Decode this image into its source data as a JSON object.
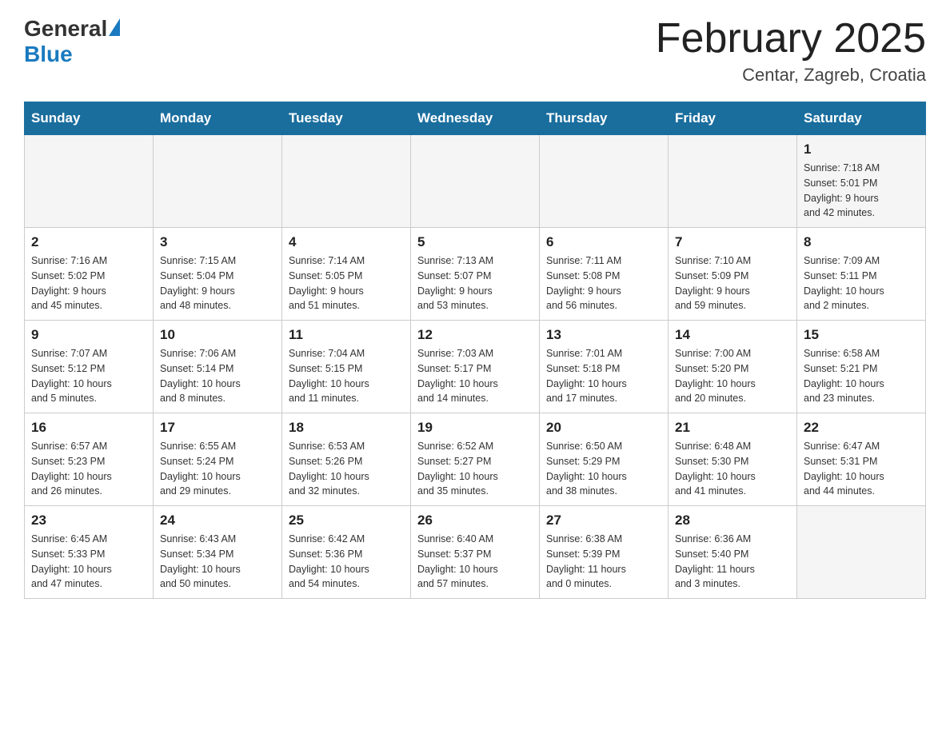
{
  "header": {
    "logo_general": "General",
    "logo_blue": "Blue",
    "month_title": "February 2025",
    "location": "Centar, Zagreb, Croatia"
  },
  "days_of_week": [
    "Sunday",
    "Monday",
    "Tuesday",
    "Wednesday",
    "Thursday",
    "Friday",
    "Saturday"
  ],
  "weeks": [
    [
      {
        "day": "",
        "info": ""
      },
      {
        "day": "",
        "info": ""
      },
      {
        "day": "",
        "info": ""
      },
      {
        "day": "",
        "info": ""
      },
      {
        "day": "",
        "info": ""
      },
      {
        "day": "",
        "info": ""
      },
      {
        "day": "1",
        "info": "Sunrise: 7:18 AM\nSunset: 5:01 PM\nDaylight: 9 hours\nand 42 minutes."
      }
    ],
    [
      {
        "day": "2",
        "info": "Sunrise: 7:16 AM\nSunset: 5:02 PM\nDaylight: 9 hours\nand 45 minutes."
      },
      {
        "day": "3",
        "info": "Sunrise: 7:15 AM\nSunset: 5:04 PM\nDaylight: 9 hours\nand 48 minutes."
      },
      {
        "day": "4",
        "info": "Sunrise: 7:14 AM\nSunset: 5:05 PM\nDaylight: 9 hours\nand 51 minutes."
      },
      {
        "day": "5",
        "info": "Sunrise: 7:13 AM\nSunset: 5:07 PM\nDaylight: 9 hours\nand 53 minutes."
      },
      {
        "day": "6",
        "info": "Sunrise: 7:11 AM\nSunset: 5:08 PM\nDaylight: 9 hours\nand 56 minutes."
      },
      {
        "day": "7",
        "info": "Sunrise: 7:10 AM\nSunset: 5:09 PM\nDaylight: 9 hours\nand 59 minutes."
      },
      {
        "day": "8",
        "info": "Sunrise: 7:09 AM\nSunset: 5:11 PM\nDaylight: 10 hours\nand 2 minutes."
      }
    ],
    [
      {
        "day": "9",
        "info": "Sunrise: 7:07 AM\nSunset: 5:12 PM\nDaylight: 10 hours\nand 5 minutes."
      },
      {
        "day": "10",
        "info": "Sunrise: 7:06 AM\nSunset: 5:14 PM\nDaylight: 10 hours\nand 8 minutes."
      },
      {
        "day": "11",
        "info": "Sunrise: 7:04 AM\nSunset: 5:15 PM\nDaylight: 10 hours\nand 11 minutes."
      },
      {
        "day": "12",
        "info": "Sunrise: 7:03 AM\nSunset: 5:17 PM\nDaylight: 10 hours\nand 14 minutes."
      },
      {
        "day": "13",
        "info": "Sunrise: 7:01 AM\nSunset: 5:18 PM\nDaylight: 10 hours\nand 17 minutes."
      },
      {
        "day": "14",
        "info": "Sunrise: 7:00 AM\nSunset: 5:20 PM\nDaylight: 10 hours\nand 20 minutes."
      },
      {
        "day": "15",
        "info": "Sunrise: 6:58 AM\nSunset: 5:21 PM\nDaylight: 10 hours\nand 23 minutes."
      }
    ],
    [
      {
        "day": "16",
        "info": "Sunrise: 6:57 AM\nSunset: 5:23 PM\nDaylight: 10 hours\nand 26 minutes."
      },
      {
        "day": "17",
        "info": "Sunrise: 6:55 AM\nSunset: 5:24 PM\nDaylight: 10 hours\nand 29 minutes."
      },
      {
        "day": "18",
        "info": "Sunrise: 6:53 AM\nSunset: 5:26 PM\nDaylight: 10 hours\nand 32 minutes."
      },
      {
        "day": "19",
        "info": "Sunrise: 6:52 AM\nSunset: 5:27 PM\nDaylight: 10 hours\nand 35 minutes."
      },
      {
        "day": "20",
        "info": "Sunrise: 6:50 AM\nSunset: 5:29 PM\nDaylight: 10 hours\nand 38 minutes."
      },
      {
        "day": "21",
        "info": "Sunrise: 6:48 AM\nSunset: 5:30 PM\nDaylight: 10 hours\nand 41 minutes."
      },
      {
        "day": "22",
        "info": "Sunrise: 6:47 AM\nSunset: 5:31 PM\nDaylight: 10 hours\nand 44 minutes."
      }
    ],
    [
      {
        "day": "23",
        "info": "Sunrise: 6:45 AM\nSunset: 5:33 PM\nDaylight: 10 hours\nand 47 minutes."
      },
      {
        "day": "24",
        "info": "Sunrise: 6:43 AM\nSunset: 5:34 PM\nDaylight: 10 hours\nand 50 minutes."
      },
      {
        "day": "25",
        "info": "Sunrise: 6:42 AM\nSunset: 5:36 PM\nDaylight: 10 hours\nand 54 minutes."
      },
      {
        "day": "26",
        "info": "Sunrise: 6:40 AM\nSunset: 5:37 PM\nDaylight: 10 hours\nand 57 minutes."
      },
      {
        "day": "27",
        "info": "Sunrise: 6:38 AM\nSunset: 5:39 PM\nDaylight: 11 hours\nand 0 minutes."
      },
      {
        "day": "28",
        "info": "Sunrise: 6:36 AM\nSunset: 5:40 PM\nDaylight: 11 hours\nand 3 minutes."
      },
      {
        "day": "",
        "info": ""
      }
    ]
  ]
}
